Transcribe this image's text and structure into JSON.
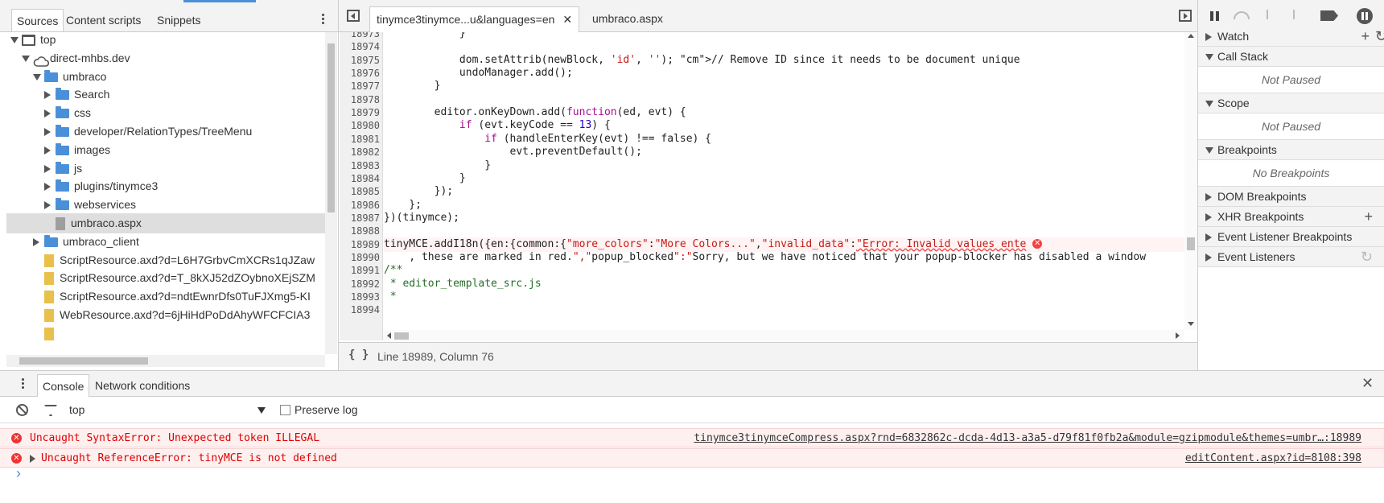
{
  "navigator": {
    "tabs": [
      "Sources",
      "Content scripts",
      "Snippets"
    ],
    "tree": [
      {
        "label": "top",
        "depth": 0,
        "icon": "frame-icon",
        "arrow": "down"
      },
      {
        "label": "direct-mhbs.dev",
        "depth": 1,
        "icon": "cloud-icon",
        "arrow": "down"
      },
      {
        "label": "umbraco",
        "depth": 2,
        "icon": "folder-icon",
        "arrow": "down"
      },
      {
        "label": "Search",
        "depth": 3,
        "icon": "folder-icon",
        "arrow": "right"
      },
      {
        "label": "css",
        "depth": 3,
        "icon": "folder-icon",
        "arrow": "right"
      },
      {
        "label": "developer/RelationTypes/TreeMenu",
        "depth": 3,
        "icon": "folder-icon",
        "arrow": "right"
      },
      {
        "label": "images",
        "depth": 3,
        "icon": "folder-icon",
        "arrow": "right"
      },
      {
        "label": "js",
        "depth": 3,
        "icon": "folder-icon",
        "arrow": "right"
      },
      {
        "label": "plugins/tinymce3",
        "depth": 3,
        "icon": "folder-icon",
        "arrow": "right"
      },
      {
        "label": "webservices",
        "depth": 3,
        "icon": "folder-icon",
        "arrow": "right"
      },
      {
        "label": "umbraco.aspx",
        "depth": 3,
        "icon": "file-icon-gray",
        "arrow": "none",
        "selected": true
      },
      {
        "label": "umbraco_client",
        "depth": 2,
        "icon": "folder-icon",
        "arrow": "right"
      },
      {
        "label": "ScriptResource.axd?d=L6H7GrbvCmXCRs1qJZaw",
        "depth": 2,
        "icon": "file-icon",
        "arrow": "none"
      },
      {
        "label": "ScriptResource.axd?d=T_8kXJ52dZOybnoXEjSZM",
        "depth": 2,
        "icon": "file-icon",
        "arrow": "none"
      },
      {
        "label": "ScriptResource.axd?d=ndtEwnrDfs0TuFJXmg5-KI",
        "depth": 2,
        "icon": "file-icon",
        "arrow": "none"
      },
      {
        "label": "WebResource.axd?d=6jHiHdPoDdAhyWFCFCIA3",
        "depth": 2,
        "icon": "file-icon",
        "arrow": "none"
      },
      {
        "label": "",
        "depth": 2,
        "icon": "file-icon",
        "arrow": "none"
      }
    ]
  },
  "editor": {
    "tabs": [
      {
        "label": "tinymce3tinymce...u&languages=en",
        "active": true
      },
      {
        "label": "umbraco.aspx",
        "active": false
      }
    ],
    "lines": [
      {
        "n": "18973",
        "code": "            }"
      },
      {
        "n": "18974",
        "code": ""
      },
      {
        "n": "18975",
        "code": "            dom.setAttrib(newBlock, 'id', ''); // Remove ID since it needs to be document unique"
      },
      {
        "n": "18976",
        "code": "            undoManager.add();"
      },
      {
        "n": "18977",
        "code": "        }"
      },
      {
        "n": "18978",
        "code": ""
      },
      {
        "n": "18979",
        "code": "        editor.onKeyDown.add(function(ed, evt) {"
      },
      {
        "n": "18980",
        "code": "            if (evt.keyCode == 13) {"
      },
      {
        "n": "18981",
        "code": "                if (handleEnterKey(evt) !== false) {"
      },
      {
        "n": "18982",
        "code": "                    evt.preventDefault();"
      },
      {
        "n": "18983",
        "code": "                }"
      },
      {
        "n": "18984",
        "code": "            }"
      },
      {
        "n": "18985",
        "code": "        });"
      },
      {
        "n": "18986",
        "code": "    };"
      },
      {
        "n": "18987",
        "code": "})(tinymce);"
      },
      {
        "n": "18988",
        "code": ""
      },
      {
        "n": "18989",
        "code": "tinyMCE.addI18n({en:{common:{\"more_colors\":\"More Colors...\",\"invalid_data\":",
        "err": "\"Error: Invalid values ente"
      },
      {
        "n": "18990",
        "code": "    , these are marked in red.\",\"popup_blocked\":\"Sorry, but we have noticed that your popup-blocker has disabled a window"
      },
      {
        "n": "18991",
        "code": "/**"
      },
      {
        "n": "18992",
        "code": " * editor_template_src.js"
      },
      {
        "n": "18993",
        "code": " *"
      },
      {
        "n": "18994",
        "code": ""
      }
    ],
    "status": "Line 18989, Column 76",
    "format_label": "{ }"
  },
  "debugger": {
    "sections": [
      {
        "key": "watch",
        "label": "Watch",
        "open": false,
        "action": "+"
      },
      {
        "key": "callstack",
        "label": "Call Stack",
        "open": true,
        "sub": "Not Paused"
      },
      {
        "key": "scope",
        "label": "Scope",
        "open": true,
        "sub": "Not Paused"
      },
      {
        "key": "breakpoints",
        "label": "Breakpoints",
        "open": true,
        "sub": "No Breakpoints"
      },
      {
        "key": "dom",
        "label": "DOM Breakpoints",
        "open": false
      },
      {
        "key": "xhr",
        "label": "XHR Breakpoints",
        "open": false,
        "action": "+"
      },
      {
        "key": "evbp",
        "label": "Event Listener Breakpoints",
        "open": false
      },
      {
        "key": "evl",
        "label": "Event Listeners",
        "open": false
      }
    ]
  },
  "drawer": {
    "tabs": [
      "Console",
      "Network conditions"
    ],
    "context": "top",
    "preserve_log": "Preserve log",
    "messages": [
      {
        "text": "Uncaught SyntaxError: Unexpected token ILLEGAL",
        "source": "tinymce3tinymceCompress.aspx?rnd=6832862c-dcda-4d13-a3a5-d79f81f0fb2a&module=gzipmodule&themes=umbr…:18989",
        "expandable": false
      },
      {
        "text": "Uncaught ReferenceError: tinyMCE is not defined",
        "source": "editContent.aspx?id=8108:398",
        "expandable": true
      }
    ],
    "prompt": "›"
  },
  "colors": {
    "error_bg": "#fff0f0",
    "error_text": "#dd0000",
    "folder": "#4a90d9",
    "file": "#e8c04a"
  }
}
